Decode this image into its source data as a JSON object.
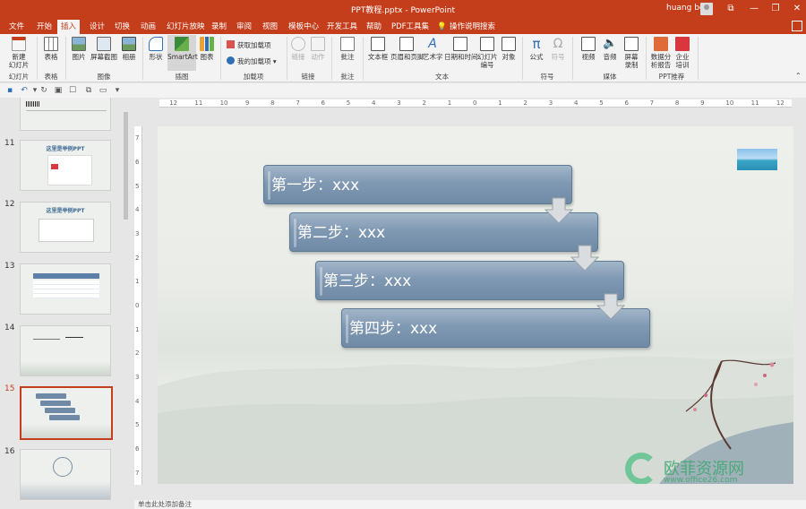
{
  "window": {
    "title": "PPT教程.pptx  -  PowerPoint",
    "user": "huang bo",
    "controls": {
      "ribbon_display": "⧉",
      "minimize": "—",
      "restore": "❐",
      "close": "✕"
    }
  },
  "tabs": [
    {
      "label": "文件",
      "active": false
    },
    {
      "label": "开始",
      "active": false
    },
    {
      "label": "插入",
      "active": true
    },
    {
      "label": "设计",
      "active": false
    },
    {
      "label": "切换",
      "active": false
    },
    {
      "label": "动画",
      "active": false
    },
    {
      "label": "幻灯片放映",
      "active": false
    },
    {
      "label": "录制",
      "active": false
    },
    {
      "label": "审阅",
      "active": false
    },
    {
      "label": "视图",
      "active": false
    },
    {
      "label": "模板中心",
      "active": false
    },
    {
      "label": "开发工具",
      "active": false
    },
    {
      "label": "帮助",
      "active": false
    },
    {
      "label": "PDF工具集",
      "active": false
    },
    {
      "label": "操作说明搜索",
      "active": false
    }
  ],
  "ribbon": {
    "buttons": {
      "new_slide": "新建\n幻灯片",
      "table": "表格",
      "picture": "图片",
      "screenshot": "屏幕截图",
      "album": "相册",
      "shapes": "形状",
      "smartart": "SmartArt",
      "chart": "图表",
      "get_addins": "获取加载项",
      "my_addins": "我的加载项",
      "link": "链接",
      "action": "动作",
      "comment": "批注",
      "textbox": "文本框",
      "header_footer": "页眉和页脚",
      "wordart": "艺术字",
      "datetime": "日期和时间",
      "slide_number": "幻灯片\n编号",
      "object": "对象",
      "equation": "公式",
      "symbol": "符号",
      "video": "视频",
      "audio": "音频",
      "screen_record": "屏幕\n录制",
      "data_analysis": "数据分\n析报告",
      "enterprise_training": "企业\n培训"
    },
    "groups": {
      "slides": "幻灯片",
      "tables": "表格",
      "images": "图像",
      "illustrations": "插图",
      "addins": "加载项",
      "links": "链接",
      "comments": "批注",
      "text": "文本",
      "symbols": "符号",
      "media": "媒体",
      "ppt_recommend": "PPT推荐"
    },
    "accent_color": "#c43e1c"
  },
  "qat": {
    "icons": [
      "save-icon",
      "undo-icon",
      "redo-icon",
      "start-slideshow-icon",
      "touch-mode-icon",
      "screenshot-icon",
      "customize-icon"
    ]
  },
  "slides_panel": {
    "thumbnails": [
      {
        "number": "",
        "title": ""
      },
      {
        "number": "11",
        "title": "这里是举例PPT"
      },
      {
        "number": "12",
        "title": "这里是举例PPT"
      },
      {
        "number": "13",
        "title": ""
      },
      {
        "number": "14",
        "title": ""
      },
      {
        "number": "15",
        "title": "",
        "selected": true
      },
      {
        "number": "16",
        "title": ""
      }
    ]
  },
  "rulers": {
    "horizontal": [
      "12",
      "11",
      "10",
      "9",
      "8",
      "7",
      "6",
      "5",
      "4",
      "3",
      "2",
      "1",
      "0",
      "1",
      "2",
      "3",
      "4",
      "5",
      "6",
      "7",
      "8",
      "9",
      "10",
      "11",
      "12"
    ],
    "vertical": [
      "7",
      "6",
      "5",
      "4",
      "3",
      "2",
      "1",
      "0",
      "1",
      "2",
      "3",
      "4",
      "5",
      "6",
      "7"
    ]
  },
  "slide": {
    "steps": [
      "第一步：xxx",
      "第二步：xxx",
      "第三步：xxx",
      "第四步：xxx"
    ],
    "step_color": "#7f97b1"
  },
  "notes": {
    "placeholder": "单击此处添加备注"
  },
  "watermark": {
    "text_main": "欧菲资源网",
    "text_url": "www.office26.com"
  }
}
